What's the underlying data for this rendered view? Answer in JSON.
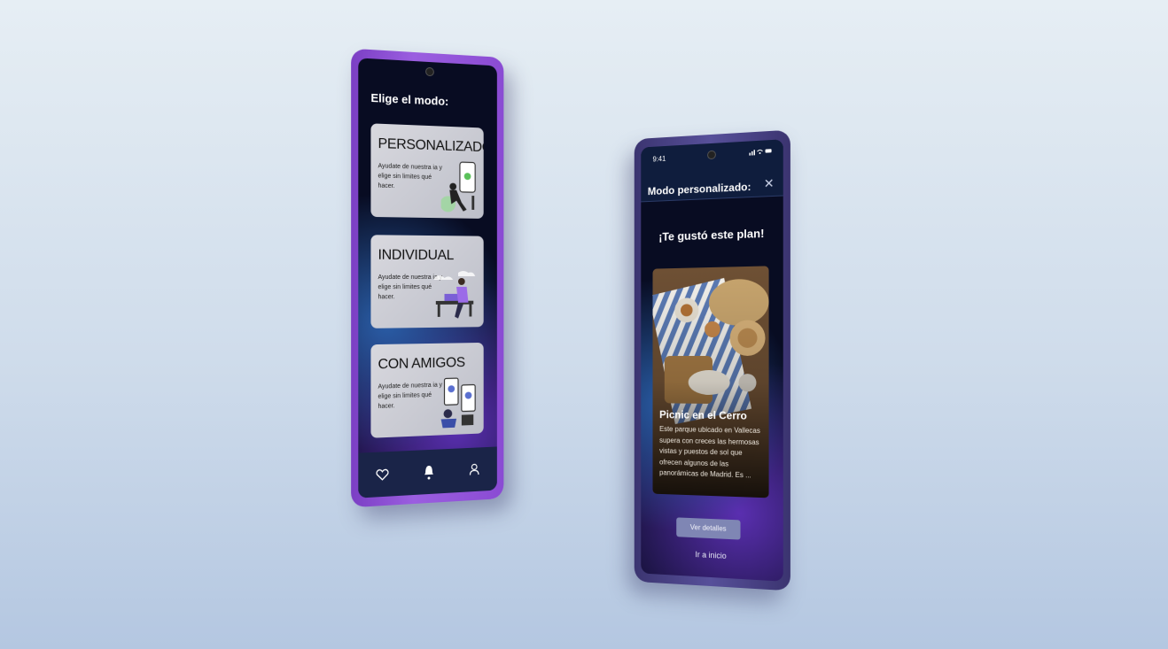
{
  "phone1": {
    "title": "Elige el modo:",
    "modes": [
      {
        "title": "PERSONALIZADO",
        "description": "Ayudate de nuestra ia y elige sin limites qué hacer."
      },
      {
        "title": "INDIVIDUAL",
        "description": "Ayudate de nuestra ia y elige sin limites qué hacer."
      },
      {
        "title": "CON AMIGOS",
        "description": "Ayudate de nuestra ia y elige sin limites qué hacer."
      }
    ],
    "nav": [
      "heart-icon",
      "bell-icon",
      "profile-icon"
    ]
  },
  "phone2": {
    "status_time": "9:41",
    "status_icons": "signal-icon wifi-icon battery-icon",
    "header_title": "Modo personalizado:",
    "liked_title": "¡Te gustó este plan!",
    "plan": {
      "name": "Picnic en el Cerro",
      "description": "Este parque ubicado en Vallecas supera con creces las hermosas vistas y puestos de sol que ofrecen algunos de las panorámicas de Madrid. Es ..."
    },
    "details_button": "Ver detalles",
    "home_link": "Ir a inicio"
  },
  "colors": {
    "phone1_frame": "#8a4bd3",
    "phone2_frame": "#3b3470",
    "screen_bg": "#080c22",
    "navbar_bg": "#1a2448",
    "button_bg": "#7f86b4"
  }
}
